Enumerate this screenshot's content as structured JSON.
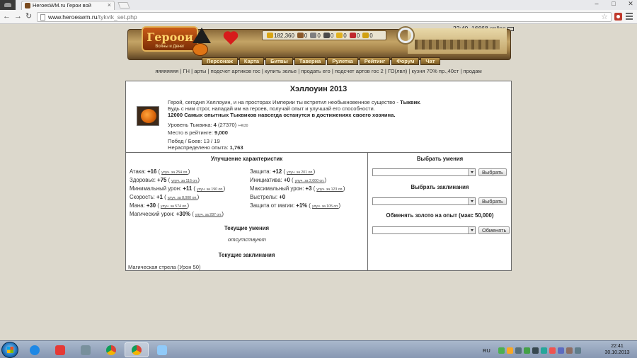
{
  "browser": {
    "tab_title": "HeroesWM.ru Герои вой",
    "url_host": "www.heroeswm.ru",
    "url_path": "/tykvik_set.php"
  },
  "server": {
    "status": "22:40, 16668 online"
  },
  "header": {
    "logo_text": "Героои",
    "logo_sub": "Войны и Денег",
    "resources": [
      {
        "value": "182,360",
        "color": "#d9a514"
      },
      {
        "value": "0",
        "color": "#8b5a2b"
      },
      {
        "value": "0",
        "color": "#7f7f7f"
      },
      {
        "value": "0",
        "color": "#4a4a4a"
      },
      {
        "value": "0",
        "color": "#e0b020"
      },
      {
        "value": "0",
        "color": "#c0282d"
      },
      {
        "value": "0",
        "color": "#d1a010"
      }
    ]
  },
  "nav": {
    "items": [
      "Персонаж",
      "Карта",
      "Битвы",
      "Таверна",
      "Рулетка",
      "Рейтинг",
      "Форум",
      "Чат"
    ]
  },
  "quicklinks": "яяяяяяяя | ГН | арты | подсчет артиков гос | купить зелье | продать его | подсчет артов гос 2 | ГО(лвл) | кузня 70% пр.,40ст | продам",
  "event": {
    "title": "Хэллоуин 2013",
    "line1_pre": "Герой, сегодня Хеллоуин, и на просторах Империи ты встретил необыкновенное существо - ",
    "line1_name": "Тыквик",
    "line2": "Будь с ним строг, нападай им на героев, получай опыт и улучшай его способности.",
    "line3": "12000 Самых опытных Тыквиков навсегда останутся в достижениях своего хозяина.",
    "level_label": "Уровень Тыквика:",
    "level_value": "4",
    "level_exp": "(27370)",
    "level_plus": "+4630",
    "rating_label": "Место в рейтинге:",
    "rating_value": "9,000",
    "battles_label": "Побед / Боев:",
    "battles_value": "13 / 19",
    "free_exp_label": "Нераспределено опыта:",
    "free_exp_value": "1,763"
  },
  "characteristics": {
    "title": "Улучшение характеристик",
    "left": [
      {
        "label": "Атака:",
        "value": "+16",
        "up": "улуч. за 254 оп."
      },
      {
        "label": "Здоровье:",
        "value": "+75",
        "up": "улуч. за 116 оп."
      },
      {
        "label": "Минимальный урон:",
        "value": "+11",
        "up": "улуч. за 190 оп."
      },
      {
        "label": "Скорость:",
        "value": "+1",
        "up": "улуч. за 8,000 оп."
      },
      {
        "label": "Мана:",
        "value": "+30",
        "up": "улуч. за 574 оп."
      },
      {
        "label": "Магический урон:",
        "value": "+30%",
        "up": "улуч. за 287 оп."
      }
    ],
    "right": [
      {
        "label": "Защита:",
        "value": "+12",
        "up": "улуч. за 201 оп."
      },
      {
        "label": "Инициатива:",
        "value": "+0",
        "up": "улуч. за 2,000 оп."
      },
      {
        "label": "Максимальный урон:",
        "value": "+3",
        "up": "улуч. за 123 оп."
      },
      {
        "label": "Выстрелы:",
        "value": "+0",
        "up": ""
      },
      {
        "label": "Защита от магии:",
        "value": "+1%",
        "up": "улуч. за 105 оп."
      }
    ]
  },
  "skills": {
    "title": "Текущие умения",
    "value": "отсутствуют"
  },
  "spells": {
    "title": "Текущие заклинания",
    "value": "Магическая стрела (Урон 50)"
  },
  "right_panel": {
    "choose_skill_title": "Выбрать умения",
    "choose_skill_btn": "Выбрать",
    "choose_spell_title": "Выбрать заклинания",
    "choose_spell_btn": "Выбрать",
    "exchange_title": "Обменять золото на опыт (макс 50,000)",
    "exchange_btn": "Обменять"
  },
  "taskbar": {
    "lang": "RU",
    "time": "22:41",
    "date": "30.10.2013"
  }
}
